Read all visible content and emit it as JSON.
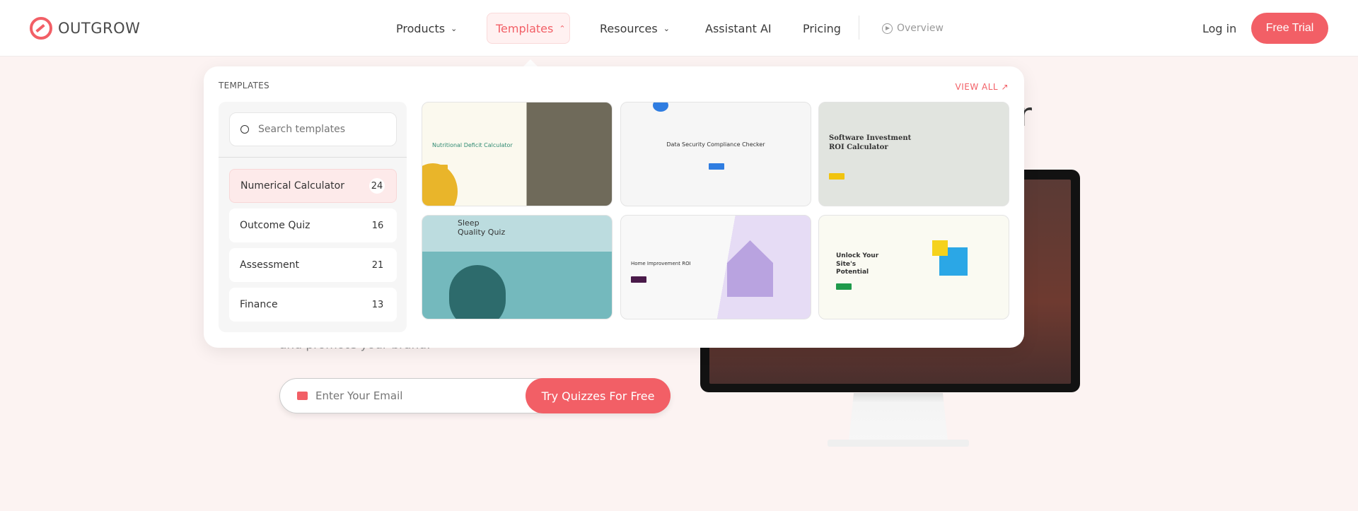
{
  "header": {
    "logo": "OUTGROW",
    "nav": [
      {
        "label": "Products",
        "chevron": "down"
      },
      {
        "label": "Templates",
        "chevron": "up",
        "active": true
      },
      {
        "label": "Resources",
        "chevron": "down"
      },
      {
        "label": "Assistant AI"
      },
      {
        "label": "Pricing"
      }
    ],
    "overview": "Overview",
    "login": "Log in",
    "free_trial": "Free Trial",
    "accent": "#f25f66"
  },
  "dropdown": {
    "label": "TEMPLATES",
    "view_all": "VIEW ALL",
    "search_placeholder": "Search templates",
    "categories": [
      {
        "label": "Numerical Calculator",
        "count": "24",
        "active": true
      },
      {
        "label": "Outcome Quiz",
        "count": "16"
      },
      {
        "label": "Assessment",
        "count": "21"
      },
      {
        "label": "Finance",
        "count": "13"
      }
    ],
    "templates": [
      {
        "title": "Nutritional Deficit Calculator"
      },
      {
        "title": "Data Security Compliance Checker"
      },
      {
        "title": "Software Investment ROI Calculator"
      },
      {
        "title": "Sleep Quality Quiz"
      },
      {
        "title": "Home Improvement ROI"
      },
      {
        "title": "Unlock Your Site's Potential"
      }
    ]
  },
  "hero": {
    "heading_fragment": "r",
    "subtext_fragment": "and promote your brand.",
    "email_placeholder": "Enter Your Email",
    "cta": "Try Quizzes For Free"
  }
}
